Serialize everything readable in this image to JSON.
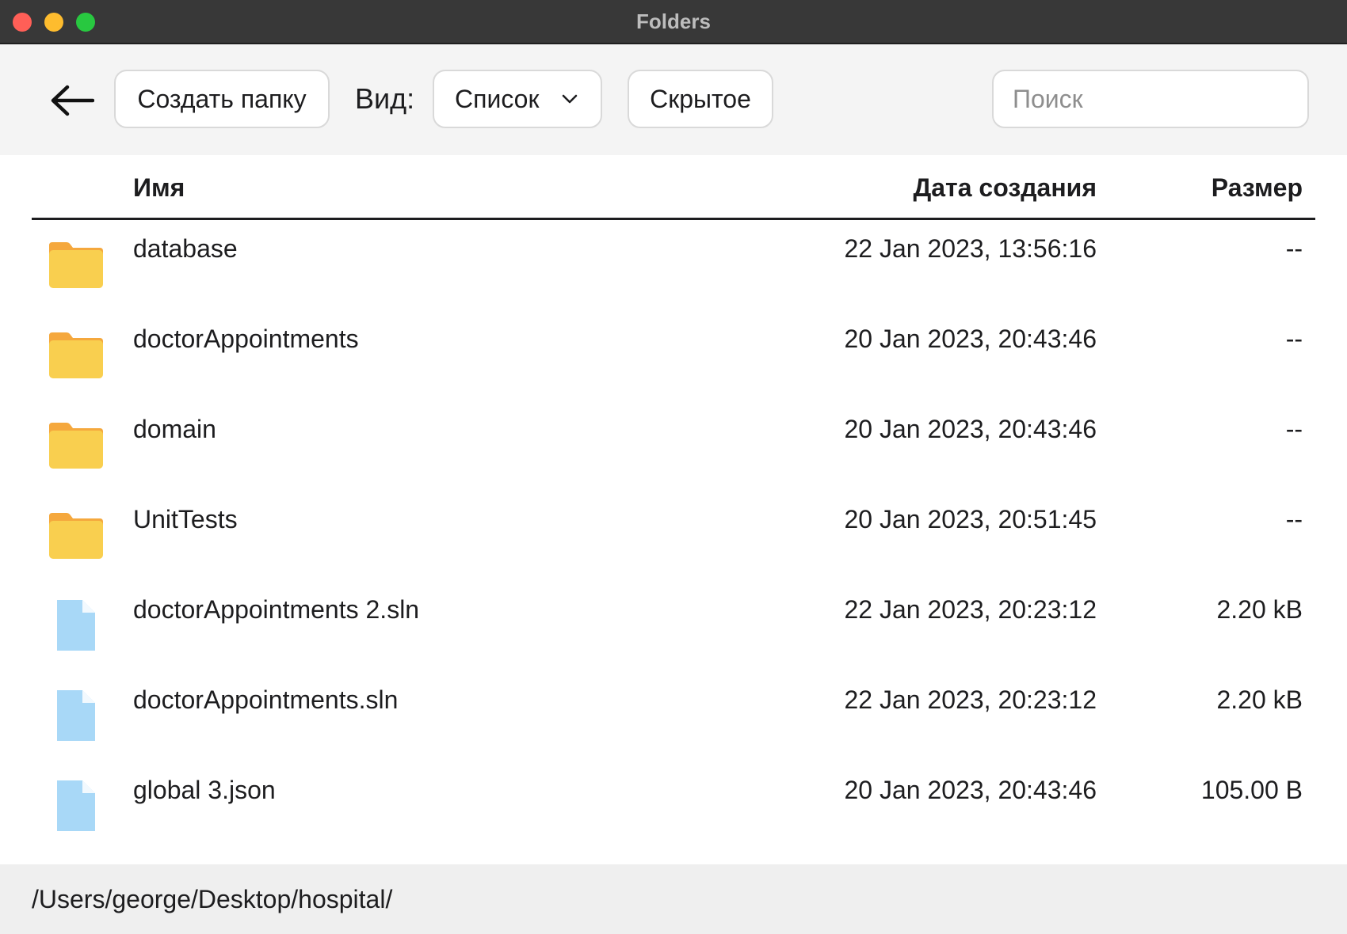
{
  "window": {
    "title": "Folders"
  },
  "toolbar": {
    "create_folder_label": "Создать папку",
    "view_label": "Вид:",
    "view_selected": "Список",
    "hidden_label": "Скрытое",
    "search_placeholder": "Поиск",
    "search_value": ""
  },
  "table": {
    "columns": {
      "name": "Имя",
      "date": "Дата создания",
      "size": "Размер"
    },
    "rows": [
      {
        "icon": "folder-icon",
        "name": "database",
        "date": "22 Jan 2023, 13:56:16",
        "size": "--"
      },
      {
        "icon": "folder-icon",
        "name": "doctorAppointments",
        "date": "20 Jan 2023, 20:43:46",
        "size": "--"
      },
      {
        "icon": "folder-icon",
        "name": "domain",
        "date": "20 Jan 2023, 20:43:46",
        "size": "--"
      },
      {
        "icon": "folder-icon",
        "name": "UnitTests",
        "date": "20 Jan 2023, 20:51:45",
        "size": "--"
      },
      {
        "icon": "file-icon",
        "name": "doctorAppointments 2.sln",
        "date": "22 Jan 2023, 20:23:12",
        "size": "2.20 kB"
      },
      {
        "icon": "file-icon",
        "name": "doctorAppointments.sln",
        "date": "22 Jan 2023, 20:23:12",
        "size": "2.20 kB"
      },
      {
        "icon": "file-icon",
        "name": "global 3.json",
        "date": "20 Jan 2023, 20:43:46",
        "size": "105.00 B"
      }
    ]
  },
  "statusbar": {
    "path": "/Users/george/Desktop/hospital/"
  },
  "colors": {
    "folder": "#f9cf4f",
    "folder_tab": "#f5a83d",
    "file": "#a8d8f7",
    "titlebar": "#383838",
    "toolbar_bg": "#f4f4f4",
    "statusbar_bg": "#efefef"
  }
}
